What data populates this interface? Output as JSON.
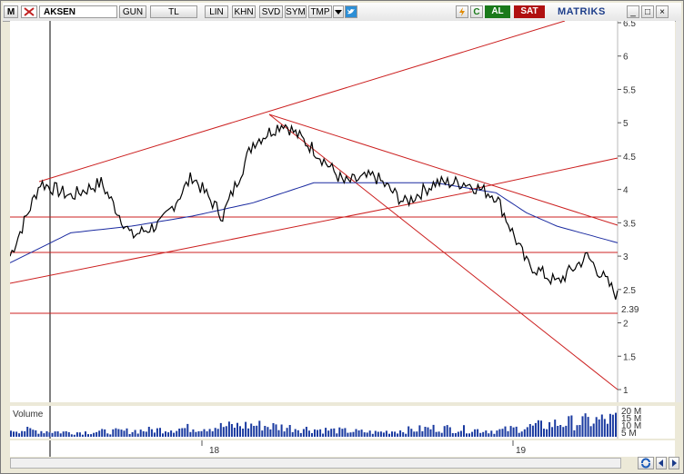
{
  "toolbar": {
    "menu_glyph": "M",
    "symbol": "AKSEN",
    "buttons": [
      "GUN",
      "TL",
      "LIN",
      "KHN",
      "SVD",
      "SYM",
      "TMP"
    ],
    "refresh_glyph": "C",
    "buy_label": "AL",
    "sell_label": "SAT",
    "brand": "MATRIKS",
    "window_controls": [
      "_",
      "□",
      "×"
    ]
  },
  "chart": {
    "price_labels": [
      "6.5",
      "6",
      "5.5",
      "5",
      "4.5",
      "4",
      "3.5",
      "3",
      "2.5",
      "2",
      "1.5",
      "1"
    ],
    "last_price_label": "2.39",
    "time_labels": [
      "18",
      "19"
    ],
    "volume_title": "Volume",
    "volume_labels": [
      "20 M",
      "15 M",
      "10 M",
      "5 M"
    ]
  },
  "chart_data": {
    "type": "line",
    "price_axis": [
      1,
      6.5
    ],
    "last_price": 2.39,
    "time_axis_labels": [
      "18",
      "19"
    ],
    "series": [
      {
        "name": "AKSEN",
        "x": [
          0,
          0.05,
          0.1,
          0.15,
          0.2,
          0.25,
          0.3,
          0.35,
          0.4,
          0.45,
          0.5,
          0.55,
          0.6,
          0.65,
          0.7,
          0.75,
          0.8,
          0.85,
          0.9,
          0.95,
          1.0
        ],
        "values": [
          3.0,
          4.1,
          3.9,
          4.1,
          3.3,
          3.5,
          4.2,
          3.6,
          4.7,
          5.0,
          4.6,
          4.1,
          4.2,
          3.8,
          4.1,
          4.1,
          3.9,
          2.9,
          2.6,
          3.0,
          2.4
        ]
      }
    ],
    "moving_average": {
      "x": [
        0,
        0.1,
        0.2,
        0.3,
        0.4,
        0.5,
        0.6,
        0.7,
        0.8,
        0.85,
        0.9,
        1.0
      ],
      "values": [
        2.9,
        3.35,
        3.45,
        3.6,
        3.8,
        4.1,
        4.1,
        4.1,
        3.95,
        3.65,
        3.45,
        3.2
      ]
    },
    "volume": {
      "x": [
        0,
        0.1,
        0.2,
        0.3,
        0.4,
        0.5,
        0.6,
        0.7,
        0.8,
        0.9,
        1.0
      ],
      "values": [
        5,
        3,
        4,
        6,
        8,
        5,
        3,
        6,
        4,
        9,
        12
      ]
    }
  }
}
